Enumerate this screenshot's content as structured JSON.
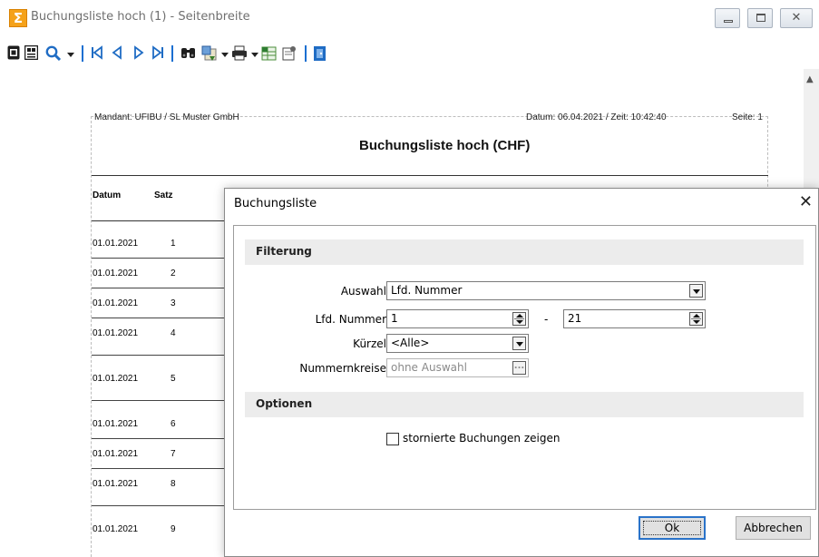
{
  "window": {
    "title": "Buchungsliste hoch (1) - Seitenbreite",
    "app_icon_glyph": "Σ",
    "minimize_glyph": "",
    "maximize_glyph": "",
    "close_glyph": "✕"
  },
  "toolbar": {
    "icons": [
      "single-page-icon",
      "multi-page-icon",
      "zoom-icon",
      "first-page-icon",
      "previous-page-icon",
      "next-page-icon",
      "last-page-icon",
      "find-icon",
      "export-icon",
      "print-icon",
      "excel-icon",
      "page-setup-icon",
      "exit-icon"
    ]
  },
  "report": {
    "mandant": "Mandant: UFIBU / SL Muster GmbH",
    "datum": "Datum: 06.04.2021 / Zeit: 10:42:40",
    "seite": "Seite: 1",
    "title": "Buchungsliste hoch (CHF)",
    "columns": [
      "Datum",
      "Satz"
    ],
    "rows": [
      {
        "datum": "01.01.2021",
        "satz": "1"
      },
      {
        "datum": "01.01.2021",
        "satz": "2"
      },
      {
        "datum": "01.01.2021",
        "satz": "3"
      },
      {
        "datum": "01.01.2021",
        "satz": "4"
      },
      {
        "datum": "01.01.2021",
        "satz": "5"
      },
      {
        "datum": "01.01.2021",
        "satz": "6"
      },
      {
        "datum": "01.01.2021",
        "satz": "7"
      },
      {
        "datum": "01.01.2021",
        "satz": "8"
      },
      {
        "datum": "01.01.2021",
        "satz": "9"
      }
    ]
  },
  "dialog": {
    "title": "Buchungsliste",
    "close_glyph": "✕",
    "filter_section": "Filterung",
    "auswahl_label": "Auswahl",
    "auswahl_value": "Lfd. Nummer",
    "lfd_label": "Lfd. Nummer",
    "lfd_from": "1",
    "lfd_separator": "-",
    "lfd_to": "21",
    "kuerzel_label": "Kürzel",
    "kuerzel_value": "<Alle>",
    "nummernkreise_label": "Nummernkreise",
    "nummernkreise_placeholder": "ohne Auswahl",
    "browse_glyph": "...",
    "options_section": "Optionen",
    "storniert_label": "stornierte Buchungen zeigen",
    "storniert_checked": false,
    "ok_label": "Ok",
    "cancel_label": "Abbrechen"
  }
}
